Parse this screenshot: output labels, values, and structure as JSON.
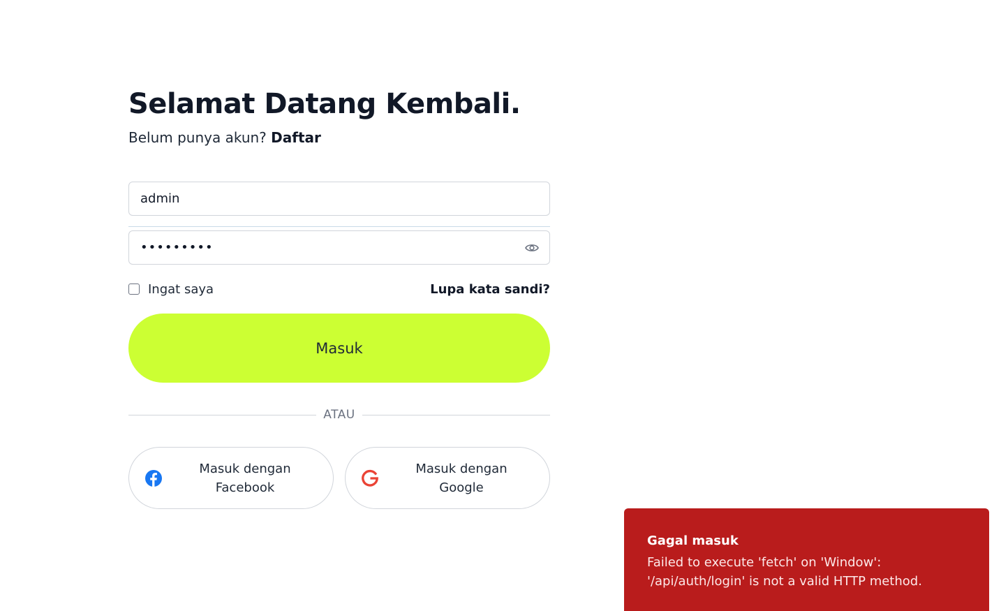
{
  "login": {
    "title": "Selamat Datang Kembali.",
    "subtitle_prefix": "Belum punya akun?",
    "register_link": "Daftar",
    "username": {
      "value": "admin",
      "placeholder": ""
    },
    "password": {
      "value": "•••••••••",
      "placeholder": ""
    },
    "remember_label": "Ingat saya",
    "forgot_link": "Lupa kata sandi?",
    "submit_label": "Masuk",
    "divider_text": "ATAU",
    "facebook_label": "Masuk dengan Facebook",
    "google_label": "Masuk dengan Google"
  },
  "toast": {
    "title": "Gagal masuk",
    "message": "Failed to execute 'fetch' on 'Window': '/api/auth/login' is not a valid HTTP method."
  },
  "colors": {
    "accent": "#ccff33",
    "error": "#b91c1c",
    "facebook": "#1877f2",
    "google": "#ea4335"
  },
  "icons": {
    "password_toggle": "eye-icon",
    "facebook": "facebook-icon",
    "google": "google-icon"
  }
}
